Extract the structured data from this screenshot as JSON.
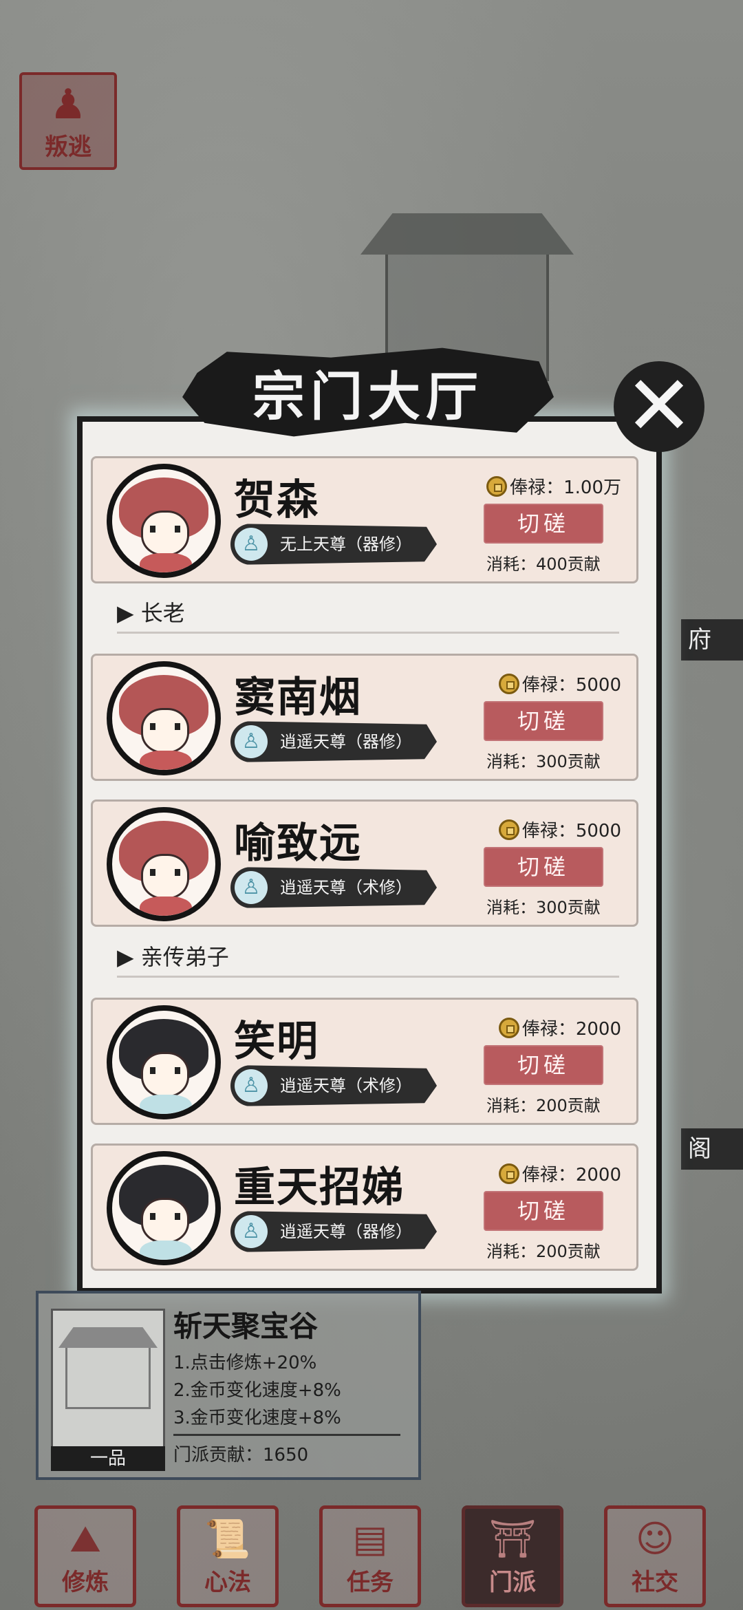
{
  "top_left": {
    "escape_label": "叛逃",
    "escape_icon": "pawn-icon"
  },
  "side_labels": [
    "府",
    "阁"
  ],
  "dialog": {
    "title": "宗门大厅",
    "close_icon": "close-icon",
    "leader": {
      "name": "贺森",
      "rank": "无上天尊（器修）",
      "salary": "俸禄：1.00万",
      "action": "切磋",
      "cost": "消耗：400贡献"
    },
    "sections": [
      {
        "header": "▶ 长老",
        "members": [
          {
            "name": "窦南烟",
            "rank": "逍遥天尊（器修）",
            "salary": "俸禄：5000",
            "action": "切磋",
            "cost": "消耗：300贡献"
          },
          {
            "name": "喻致远",
            "rank": "逍遥天尊（术修）",
            "salary": "俸禄：5000",
            "action": "切磋",
            "cost": "消耗：300贡献"
          }
        ]
      },
      {
        "header": "▶ 亲传弟子",
        "members": [
          {
            "name": "笑明",
            "rank": "逍遥天尊（术修）",
            "salary": "俸禄：2000",
            "action": "切磋",
            "cost": "消耗：200贡献"
          },
          {
            "name": "重天招娣",
            "rank": "逍遥天尊（器修）",
            "salary": "俸禄：2000",
            "action": "切磋",
            "cost": "消耗：200贡献"
          }
        ]
      }
    ]
  },
  "info_panel": {
    "title": "斩天聚宝谷",
    "grade": "一品",
    "buffs": [
      "1.点击修炼+20%",
      "2.金币变化速度+8%",
      "3.金币变化速度+8%"
    ],
    "contribution": "门派贡献：1650"
  },
  "nav": {
    "active": "门派",
    "tabs": [
      {
        "label": "修炼",
        "icon": "mountain-icon"
      },
      {
        "label": "心法",
        "icon": "scroll-icon"
      },
      {
        "label": "任务",
        "icon": "document-icon"
      },
      {
        "label": "门派",
        "icon": "pavilion-icon"
      },
      {
        "label": "社交",
        "icon": "people-icon"
      }
    ]
  },
  "colors": {
    "accent_red": "#b85b5e",
    "seal_red": "#7b2a2a",
    "card_bg": "#f3e6de",
    "dialog_bg": "#f1efec",
    "ink": "#1a1a1a"
  }
}
